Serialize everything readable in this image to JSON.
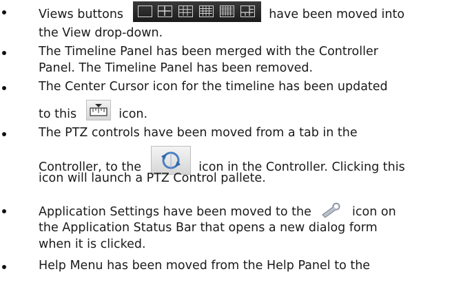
{
  "bullets": [
    {
      "pre": "Views buttons",
      "post": "have been moved into",
      "line2": "the View drop-down."
    },
    {
      "line1": "The Timeline Panel has been merged with the Controller",
      "line2": "Panel.  The Timeline Panel has been removed."
    },
    {
      "line1": "The Center Cursor icon for the timeline has been updated",
      "pre2": "to this",
      "post2": "icon."
    },
    {
      "line1": "The PTZ controls have been moved from a tab in the",
      "pre2": "Controller, to the",
      "post2": "icon in the Controller.  Clicking this",
      "line3": "icon will launch a PTZ Control pallete."
    },
    {
      "pre1": "Application Settings have been moved to the",
      "post1": "icon on",
      "line2": "the Application Status Bar that opens a new dialog form",
      "line3": "when it is clicked."
    },
    {
      "line1": "Help Menu has been moved from the Help Panel to the"
    }
  ],
  "icons": {
    "views_buttons": [
      "single-view-icon",
      "2x2-grid-icon",
      "3x3-grid-icon",
      "4x4-grid-icon",
      "5x5-grid-icon",
      "1plus5-grid-icon"
    ],
    "center_cursor": "center-cursor-icon",
    "ptz": "ptz-control-icon",
    "settings": "wrench-icon"
  },
  "colors": {
    "views_strip_bg": "#2a2a2a",
    "text": "#1a1a1a"
  }
}
